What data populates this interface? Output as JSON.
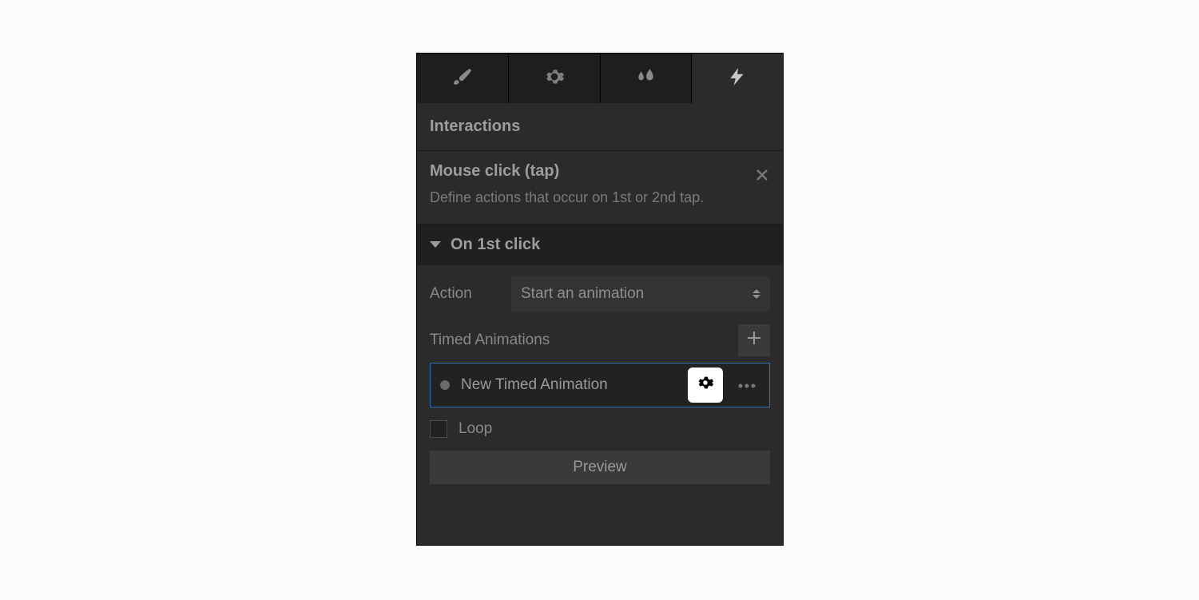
{
  "tabs": [
    "brush",
    "gear",
    "drops",
    "lightning"
  ],
  "activeTab": 3,
  "sectionTitle": "Interactions",
  "trigger": {
    "title": "Mouse click (tap)",
    "description": "Define actions that occur on 1st or 2nd tap."
  },
  "collapseLabel": "On 1st click",
  "actionLabel": "Action",
  "actionSelected": "Start an animation",
  "timedAnimationsLabel": "Timed Animations",
  "animationItem": {
    "name": "New Timed Animation"
  },
  "loopLabel": "Loop",
  "loopChecked": false,
  "previewLabel": "Preview"
}
